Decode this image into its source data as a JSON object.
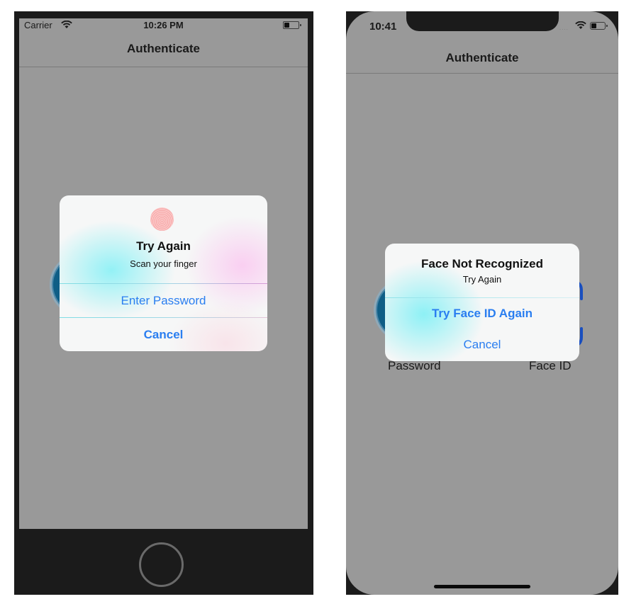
{
  "phones": [
    {
      "model": "Touch ID device",
      "status_bar": {
        "carrier": "Carrier",
        "time": "10:26 PM",
        "battery_level": 0.35
      },
      "nav": {
        "title": "Authenticate"
      },
      "alert": {
        "icon": "fingerprint-icon",
        "title": "Try Again",
        "message": "Scan your finger",
        "buttons": [
          {
            "label": "Enter Password",
            "style": "default"
          },
          {
            "label": "Cancel",
            "style": "bold"
          }
        ]
      }
    },
    {
      "model": "Face ID device",
      "status_bar": {
        "time": "10:41",
        "signal": "....",
        "battery_level": 0.35
      },
      "nav": {
        "title": "Authenticate"
      },
      "background_labels": {
        "password": "Password",
        "face_id": "Face ID"
      },
      "alert": {
        "title": "Face Not Recognized",
        "message": "Try Again",
        "buttons": [
          {
            "label": "Try Face ID Again",
            "style": "bold"
          },
          {
            "label": "Cancel",
            "style": "default"
          }
        ]
      }
    }
  ],
  "colors": {
    "dimmed_background": "#999999",
    "device_frame": "#1b1b1b",
    "action_blue": "#2a7ef0",
    "touch_id_red": "#b01c52",
    "face_id_blue": "#1a4fc0",
    "password_blue": "#0f5e86"
  }
}
